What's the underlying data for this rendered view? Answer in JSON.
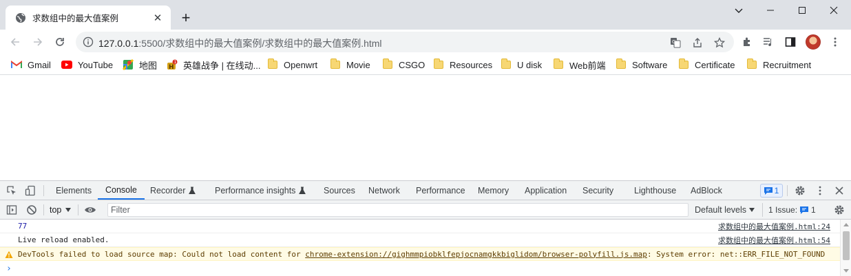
{
  "browser": {
    "tab": {
      "title": "求数组中的最大值案例",
      "close_label": "✕"
    },
    "new_tab_label": "+",
    "window": {
      "minimize": "⌄",
      "restore": "─",
      "maximize": "☐",
      "close": "✕"
    },
    "address": {
      "host": "127.0.0.1",
      "rest": ":5500/求数组中的最大值案例/求数组中的最大值案例.html"
    }
  },
  "bookmarks": [
    {
      "label": "Gmail",
      "icon": "gmail-icon"
    },
    {
      "label": "YouTube",
      "icon": "youtube-icon"
    },
    {
      "label": "地图",
      "icon": "maps-icon"
    },
    {
      "label": "英雄战争 | 在线动...",
      "icon": "game-icon"
    },
    {
      "label": "Openwrt",
      "icon": "folder-icon"
    },
    {
      "label": "Movie",
      "icon": "folder-icon"
    },
    {
      "label": "CSGO",
      "icon": "folder-icon"
    },
    {
      "label": "Resources",
      "icon": "folder-icon"
    },
    {
      "label": "U disk",
      "icon": "folder-icon"
    },
    {
      "label": "Web前端",
      "icon": "folder-icon"
    },
    {
      "label": "Software",
      "icon": "folder-icon"
    },
    {
      "label": "Certificate",
      "icon": "folder-icon"
    },
    {
      "label": "Recruitment",
      "icon": "folder-icon"
    }
  ],
  "devtools": {
    "tabs": [
      "Elements",
      "Console",
      "Recorder",
      "Performance insights",
      "Sources",
      "Network",
      "Performance",
      "Memory",
      "Application",
      "Security",
      "Lighthouse",
      "AdBlock"
    ],
    "active_tab": "Console",
    "issues_badge": "1",
    "context": "top",
    "filter_placeholder": "Filter",
    "levels_label": "Default levels",
    "issue_count_label": "1 Issue:",
    "issue_count": "1",
    "console": {
      "rows": [
        {
          "text": "77",
          "source": "求数组中的最大值案例.html:24"
        },
        {
          "text": "Live reload enabled.",
          "source": "求数组中的最大值案例.html:54"
        }
      ],
      "warning": {
        "prefix": "DevTools failed to load source map: Could not load content for ",
        "link": "chrome-extension://gighmmpiobklfepjocnamgkkbiglidom/browser-polyfill.js.map",
        "suffix": ": System error: net::ERR_FILE_NOT_FOUND"
      },
      "prompt": "›"
    }
  },
  "colors": {
    "tabstrip": "#dee1e6",
    "accent": "#1a73e8",
    "warning_bg": "#fffbe5",
    "folder": "#f7d774"
  }
}
